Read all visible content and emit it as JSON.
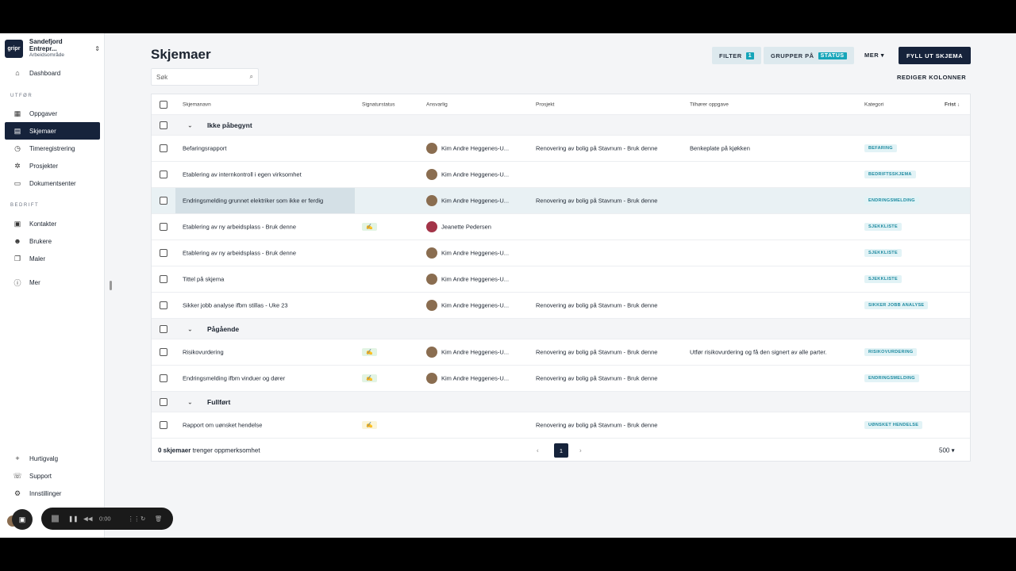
{
  "workspace": {
    "logo": "gripr",
    "name": "Sandefjord Entrepr...",
    "subtitle": "Arbeidsområde"
  },
  "sidebar": {
    "top": [
      {
        "label": "Dashboard",
        "icon": "home-icon"
      }
    ],
    "section_utfor": "UTFØR",
    "utfor": [
      {
        "label": "Oppgaver",
        "icon": "calendar-icon"
      },
      {
        "label": "Skjemaer",
        "icon": "form-icon",
        "active": true
      },
      {
        "label": "Timeregistrering",
        "icon": "clock-icon"
      },
      {
        "label": "Prosjekter",
        "icon": "project-icon"
      },
      {
        "label": "Dokumentsenter",
        "icon": "folder-icon"
      }
    ],
    "section_bedrift": "BEDRIFT",
    "bedrift": [
      {
        "label": "Kontakter",
        "icon": "contacts-icon"
      },
      {
        "label": "Brukere",
        "icon": "user-icon"
      },
      {
        "label": "Maler",
        "icon": "template-icon"
      }
    ],
    "more": "Mer",
    "bottom": [
      {
        "label": "Hurtigvalg",
        "icon": "plus-icon"
      },
      {
        "label": "Support",
        "icon": "support-icon"
      },
      {
        "label": "Innstillinger",
        "icon": "gear-icon"
      }
    ]
  },
  "page": {
    "title": "Skjemaer",
    "search_placeholder": "Søk",
    "filter_label": "FILTER",
    "filter_count": "1",
    "group_label": "GRUPPER PÅ",
    "group_value": "STATUS",
    "more_label": "MER",
    "fill_label": "FYLL UT SKJEMA",
    "edit_columns": "REDIGER KOLONNER"
  },
  "table": {
    "columns": [
      "Skjemanavn",
      "Signaturstatus",
      "Ansvarlig",
      "Prosjekt",
      "Tilhører oppgave",
      "Kategori",
      "Frist"
    ],
    "groups": [
      {
        "name": "Ikke påbegynt",
        "rows": [
          {
            "name": "Befaringsrapport",
            "sig": "",
            "owner": "Kim Andre Heggenes-U...",
            "project": "Renovering av bolig på Stavnum - Bruk denne",
            "task": "Benkeplate på kjøkken",
            "category": "BEFARING"
          },
          {
            "name": "Etablering av internkontroll i egen virksomhet",
            "sig": "",
            "owner": "Kim Andre Heggenes-U...",
            "project": "",
            "task": "",
            "category": "BEDRIFTSSKJEMA"
          },
          {
            "name": "Endringsmelding grunnet elektriker som ikke er ferdig",
            "sig": "",
            "owner": "Kim Andre Heggenes-U...",
            "project": "Renovering av bolig på Stavnum - Bruk denne",
            "task": "",
            "category": "ENDRINGSMELDING"
          },
          {
            "name": "Etablering av ny arbeidsplass - Bruk denne",
            "sig": "green",
            "owner": "Jeanette Pedersen",
            "project": "",
            "task": "",
            "category": "SJEKKLISTE"
          },
          {
            "name": "Etablering av ny arbeidsplass - Bruk denne",
            "sig": "",
            "owner": "Kim Andre Heggenes-U...",
            "project": "",
            "task": "",
            "category": "SJEKKLISTE"
          },
          {
            "name": "Tittel på skjema",
            "sig": "",
            "owner": "Kim Andre Heggenes-U...",
            "project": "",
            "task": "",
            "category": "SJEKKLISTE"
          },
          {
            "name": "Sikker jobb analyse ifbm stillas - Uke 23",
            "sig": "",
            "owner": "Kim Andre Heggenes-U...",
            "project": "Renovering av bolig på Stavnum - Bruk denne",
            "task": "",
            "category": "SIKKER JOBB ANALYSE"
          }
        ]
      },
      {
        "name": "Pågående",
        "rows": [
          {
            "name": "Risikovurdering",
            "sig": "green",
            "owner": "Kim Andre Heggenes-U...",
            "project": "Renovering av bolig på Stavnum - Bruk denne",
            "task": "Utfør risikovurdering og få den signert av alle parter.",
            "category": "RISIKOVURDERING"
          },
          {
            "name": "Endringsmelding ifbm vinduer og dører",
            "sig": "green",
            "owner": "Kim Andre Heggenes-U...",
            "project": "Renovering av bolig på Stavnum - Bruk denne",
            "task": "",
            "category": "ENDRINGSMELDING"
          }
        ]
      },
      {
        "name": "Fullført",
        "rows": [
          {
            "name": "Rapport om uønsket hendelse",
            "sig": "yellow",
            "owner": "",
            "project": "Renovering av bolig på Stavnum - Bruk denne",
            "task": "",
            "category": "UØNSKET HENDELSE"
          }
        ]
      }
    ]
  },
  "footer": {
    "count": "0 skjemaer",
    "count_suffix": "trenger oppmerksomhet",
    "page": "1",
    "per_page": "500"
  },
  "recorder": {
    "time": "0:00"
  },
  "colors": {
    "navy": "#16233b",
    "accent": "#16a5b9"
  }
}
